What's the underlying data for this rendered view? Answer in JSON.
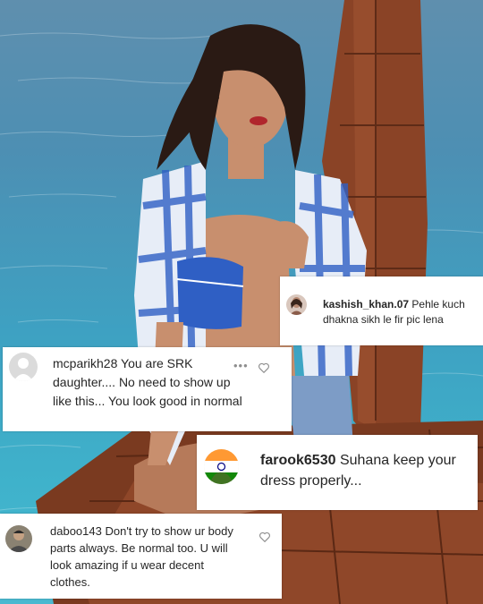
{
  "comments": [
    {
      "username": "kashish_khan.07",
      "text": "Pehle kuch dhakna sikh le fir pic lena",
      "avatar_icon": "woman-avatar-icon"
    },
    {
      "username": "mcparikh28",
      "text": "You are SRK daughter.... No need to show up like this... You look good in normal",
      "avatar_icon": "default-user-avatar-icon",
      "more_icon": "more-options-icon",
      "like_icon": "heart-icon"
    },
    {
      "username": "farook6530",
      "text": "Suhana keep your dress properly...",
      "avatar_icon": "india-flag-avatar-icon"
    },
    {
      "username": "daboo143",
      "text": "Don't try to show ur body parts always. Be normal too. U will look amazing if u wear decent clothes.",
      "avatar_icon": "man-avatar-icon",
      "like_icon": "heart-icon"
    }
  ],
  "colors": {
    "sea": "#3ea1c2",
    "text": "#262626",
    "icon_grey": "#8e8e8e",
    "wood": "#8a4326",
    "shirt_blue": "#2f5fc4"
  }
}
